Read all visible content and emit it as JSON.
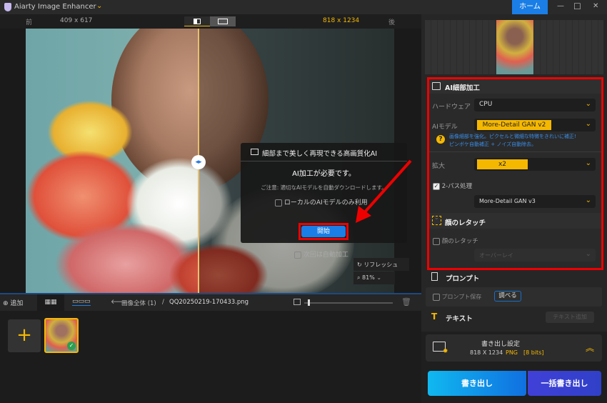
{
  "app": {
    "title": "Aiarty Image Enhancer",
    "home": "ホーム",
    "minimize": "—",
    "maximize": "☐",
    "close": "✕"
  },
  "compare": {
    "before": "前",
    "before_size": "409 x 617",
    "after_size": "818 x 1234",
    "after": "後"
  },
  "dialog": {
    "header": "細部まで美しく再現できる高画質化AI",
    "title": "AI加工が必要です。",
    "note": "ご注意: 適切なAIモデルを自動ダウンロードします。",
    "local_only": "ローカルのAIモデルのみ利用",
    "start": "開始",
    "auto_next": "次回は自動加工"
  },
  "view": {
    "refresh": "リフレッシュ",
    "zoom": "81%"
  },
  "toolbar": {
    "add": "追加",
    "breadcrumb_root": "画像全体 (1)",
    "separator": "/",
    "filename": "QQ20250219-170433.png"
  },
  "panel": {
    "ai_section": "AI細部加工",
    "hardware_label": "ハードウェア",
    "hardware": "CPU",
    "model_label": "AIモデル",
    "model": "More-Detail GAN  v2",
    "model_desc_1": "画像細部を強化。ピクセルと微細な特徴をきれいに補正!",
    "model_desc_2": "ピンボケ自動補正 + ノイズ自動除去。",
    "scale_label": "拡大",
    "scale": "x2",
    "two_pass_label": "2-パス処理",
    "two_pass_checked": true,
    "two_pass_model": "More-Detail GAN  v3",
    "face_section": "顔のレタッチ",
    "face_label": "顔のレタッチ",
    "face_mode": "オーバーレイ",
    "prompt_section": "プロンプト",
    "prompt_save": "プロンプト保存",
    "prompt_lookup": "調べる",
    "text_section": "テキスト",
    "text_add": "テキスト追加",
    "export_title": "書き出し設定",
    "export_size": "818 X 1234",
    "export_format": "PNG",
    "export_bits": "[8 bits]",
    "export_btn": "書き出し",
    "batch_export_btn": "一括書き出し"
  },
  "colors": {
    "accent": "#f5b800",
    "blue": "#1a7ee6",
    "highlight": "#e00000"
  }
}
